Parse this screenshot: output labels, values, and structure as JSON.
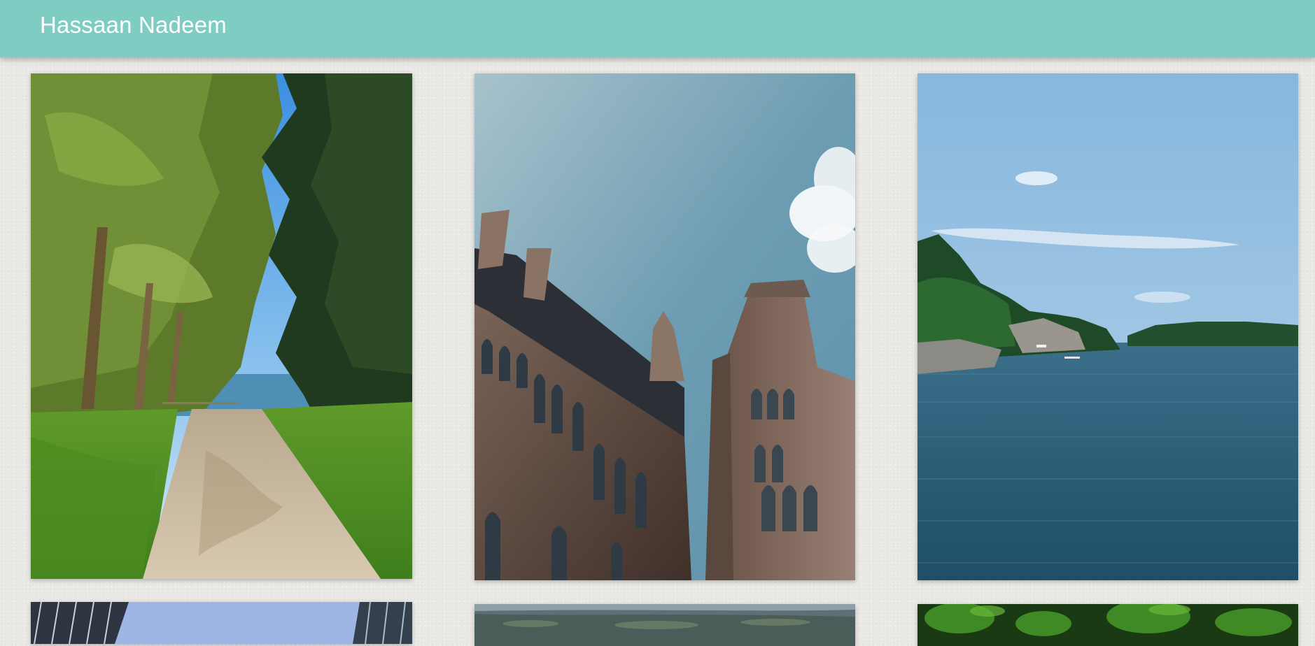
{
  "header": {
    "title": "Hassaan Nadeem"
  },
  "gallery": {
    "photos": [
      {
        "icon": "forest-path-photo"
      },
      {
        "icon": "gothic-building-photo"
      },
      {
        "icon": "lake-islands-photo"
      },
      {
        "icon": "city-towers-photo"
      },
      {
        "icon": "aerial-landscape-photo"
      },
      {
        "icon": "green-trees-photo"
      }
    ]
  },
  "colors": {
    "header_bg": "#7ecdc2",
    "page_bg": "#ebe9e5",
    "header_text": "#ffffff"
  }
}
